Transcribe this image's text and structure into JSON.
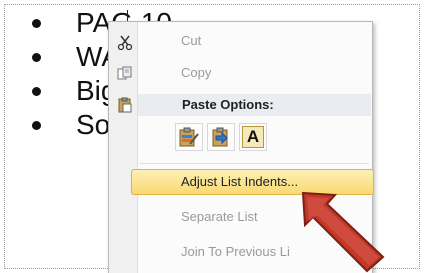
{
  "document": {
    "bullets": [
      {
        "text": "PAG 10"
      },
      {
        "text": "WA"
      },
      {
        "text": "Big"
      },
      {
        "text": "So"
      }
    ]
  },
  "context_menu": {
    "cut": {
      "label": "Cut",
      "icon": "scissors-icon"
    },
    "copy": {
      "label": "Copy",
      "icon": "copy-icon"
    },
    "paste_options": {
      "label": "Paste Options:",
      "icon": "clipboard-icon"
    },
    "paste_buttons": [
      {
        "name": "paste-use-destination-theme",
        "icon": "brush-clipboard-icon"
      },
      {
        "name": "paste-merge-formatting",
        "icon": "arrow-clipboard-icon"
      },
      {
        "name": "paste-keep-text-only",
        "icon": "text-a-icon",
        "glyph": "A"
      }
    ],
    "adjust_list_indents": {
      "label": "Adjust List Indents..."
    },
    "separate_list": {
      "label": "Separate List"
    },
    "join_to_previous": {
      "label": "Join To Previous Li"
    }
  },
  "colors": {
    "highlight_top": "#fdf0b4",
    "highlight_bottom": "#f9d972",
    "arrow": "#c0392b"
  }
}
